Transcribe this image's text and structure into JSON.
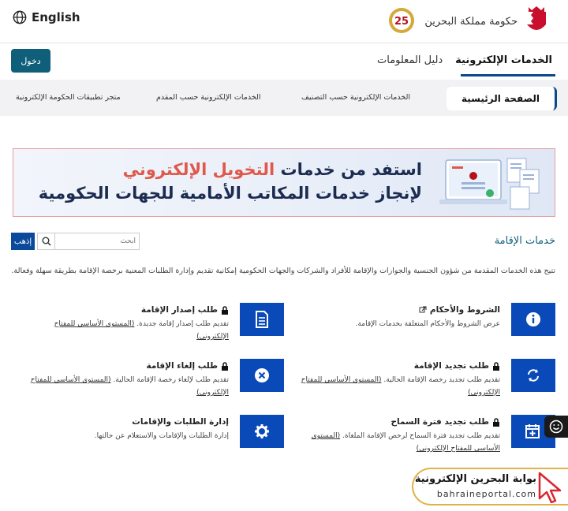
{
  "topbar": {
    "language_label": "English",
    "gov_name": "حكومة مملكة البحرين",
    "anniversary": "25"
  },
  "nav": {
    "login_label": "دخول",
    "tabs": [
      {
        "label": "الخدمات الإلكترونية",
        "active": true
      },
      {
        "label": "دليل المعلومات",
        "active": false
      }
    ]
  },
  "subnav": {
    "items": [
      {
        "label": "الصفحة الرئيسية",
        "active": true
      },
      {
        "label": "الخدمات الإلكترونية حسب التصنيف"
      },
      {
        "label": "الخدمات الإلكترونية حسب المقدم"
      },
      {
        "label": "متجر تطبيقات الحكومة الإلكترونية"
      }
    ]
  },
  "banner": {
    "line1_prefix": "استفد من خدمات",
    "line1_highlight": "التخويل الإلكتروني",
    "line2": "لإنجاز خدمات المكاتب الأمامية للجهات الحكومية"
  },
  "search": {
    "go_label": "إذهب",
    "placeholder": "ابحث"
  },
  "section": {
    "title": "خدمات الإقامة",
    "intro": "تتيح هذه الخدمات المقدمة من شؤون الجنسية والجوازات والإقامة للأفراد والشركات والجهات الحكومية إمكانية تقديم وإدارة الطلبات المعنية برخصة الإقامة بطريقة سهلة وفعالة."
  },
  "services": [
    {
      "title": "الشروط والأحكام",
      "desc": "عرض الشروط والأحكام المتعلقة بخدمات الإقامة.",
      "link": "",
      "icon": "info-icon",
      "locked": false,
      "external": true
    },
    {
      "title": "طلب إصدار الإقامة",
      "desc": "تقديم طلب إصدار إقامة جديدة.",
      "link": "(المستوى الأساسي للمفتاح الإلكتروني)",
      "icon": "document-icon",
      "locked": true,
      "external": false
    },
    {
      "title": "طلب تجديد الإقامة",
      "desc": "تقديم طلب تجديد رخصة الإقامة الحالية.",
      "link": "(المستوى الأساسي للمفتاح الإلكتروني)",
      "icon": "refresh-icon",
      "locked": true,
      "external": false
    },
    {
      "title": "طلب إلغاء الإقامة",
      "desc": "تقديم طلب لإلغاء رخصة الإقامة الحالية.",
      "link": "(المستوى الأساسي للمفتاح الإلكتروني)",
      "icon": "cancel-icon",
      "locked": true,
      "external": false
    },
    {
      "title": "طلب تجديد فترة السماح",
      "desc": "تقديم طلب تجديد فترة السماح لرخص الإقامة الملغاة.",
      "link": "(المستوى الأساسي للمفتاح الإلكتروني)",
      "icon": "calendar-add-icon",
      "locked": true,
      "external": false
    },
    {
      "title": "إدارة الطلبات والإقامات",
      "desc": "إدارة الطلبات والإقامات والاستعلام عن حالتها.",
      "link": "",
      "icon": "gear-icon",
      "locked": false,
      "external": false
    }
  ],
  "watermark": {
    "title": "بوابة البحرين الإلكترونية",
    "url": "bahraineportal.com"
  },
  "colors": {
    "brand_blue": "#0a4ab8",
    "login_teal": "#0f5f7a",
    "highlight_red": "#e0584a"
  }
}
